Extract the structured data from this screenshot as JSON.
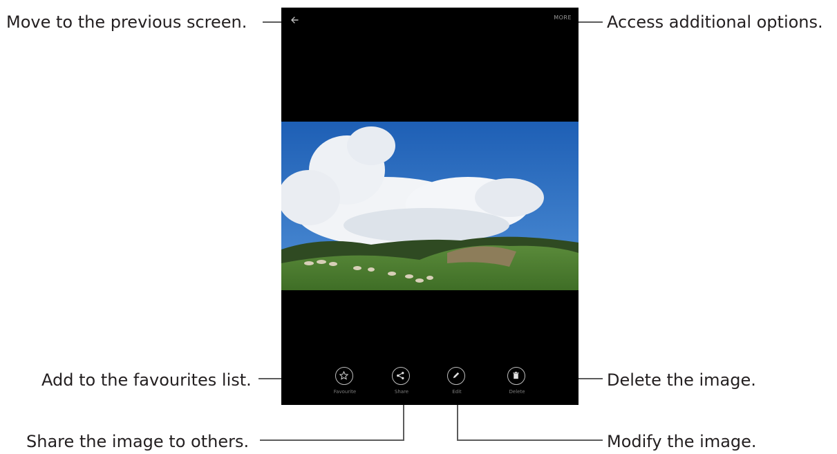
{
  "callouts": {
    "back": "Move to the previous screen.",
    "more": "Access additional options.",
    "favourite": "Add to the favourites list.",
    "delete": "Delete the image.",
    "share": "Share the image to others.",
    "edit": "Modify the image."
  },
  "screen": {
    "more_label": "MORE",
    "actions": [
      {
        "icon": "star-icon",
        "label": "Favourite"
      },
      {
        "icon": "share-icon",
        "label": "Share"
      },
      {
        "icon": "pencil-icon",
        "label": "Edit"
      },
      {
        "icon": "trash-icon",
        "label": "Delete"
      }
    ]
  },
  "colors": {
    "screen_bg": "#000000",
    "leader_line": "#5b5b5b",
    "text": "#231f20"
  }
}
